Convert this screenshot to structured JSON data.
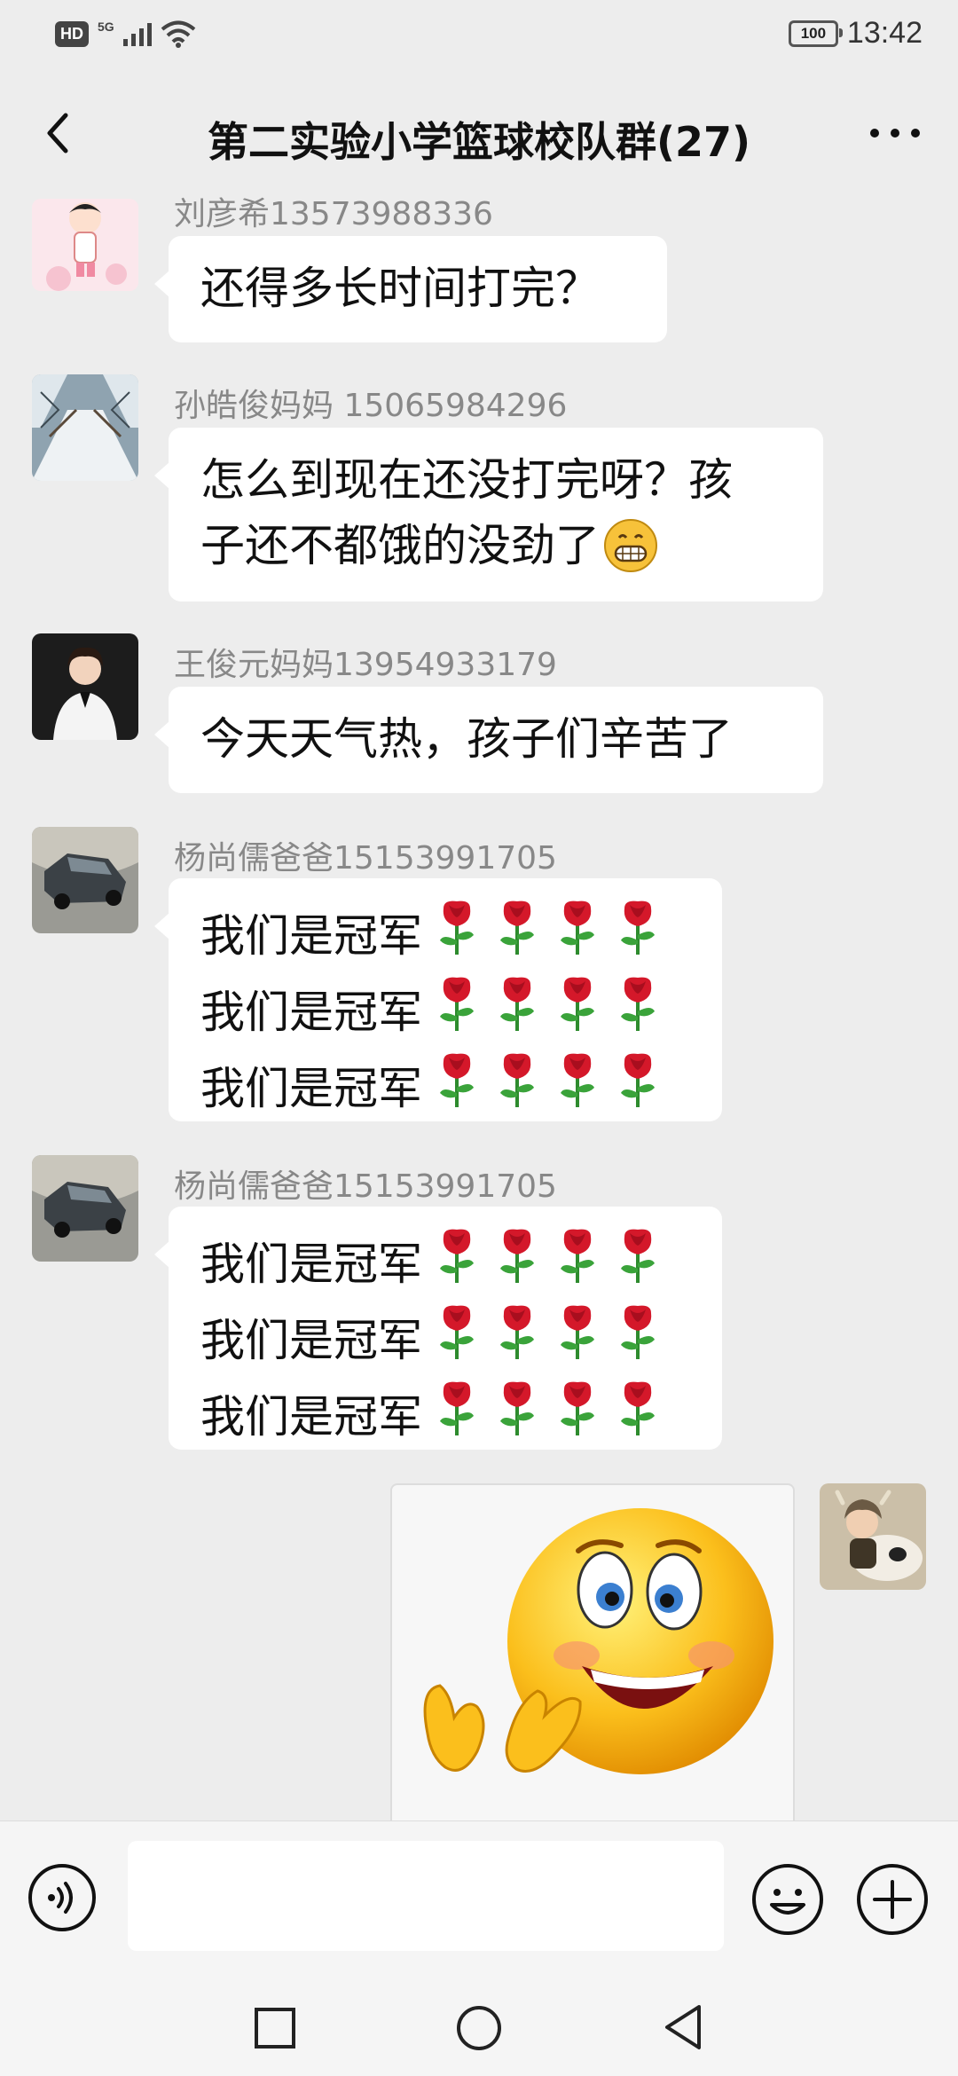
{
  "status_bar": {
    "network": "HD",
    "network_gen": "5G",
    "battery": "100",
    "time": "13:42"
  },
  "header": {
    "title": "第二实验小学篮球校队群(27)",
    "back_icon": "chevron-left-icon",
    "more_icon": "more-dots-icon"
  },
  "messages": [
    {
      "sender": "刘彦希13573988336",
      "lines": [
        "还得多长时间打完？"
      ]
    },
    {
      "sender": "孙皓俊妈妈  15065984296",
      "lines": [
        "怎么到现在还没打完呀？孩",
        "子还不都饿的没劲了"
      ],
      "emoji": "grinning-face"
    },
    {
      "sender": "王俊元妈妈13954933179",
      "lines": [
        "今天天气热，孩子们辛苦了"
      ]
    },
    {
      "sender": "杨尚儒爸爸15153991705",
      "lines": [
        "我们是冠军",
        "我们是冠军",
        "我们是冠军"
      ],
      "emoji": "rose",
      "emoji_count": 4
    },
    {
      "sender": "杨尚儒爸爸15153991705",
      "lines": [
        "我们是冠军",
        "我们是冠军",
        "我们是冠军"
      ],
      "emoji": "rose",
      "emoji_count": 4
    }
  ],
  "my_message": {
    "type": "sticker",
    "sticker": "clapping-smiley-sticker"
  },
  "input": {
    "value": "",
    "placeholder": ""
  },
  "colors": {
    "background": "#ededed",
    "bubble": "#ffffff",
    "sender": "#888888",
    "input_bar": "#f5f5f5"
  }
}
